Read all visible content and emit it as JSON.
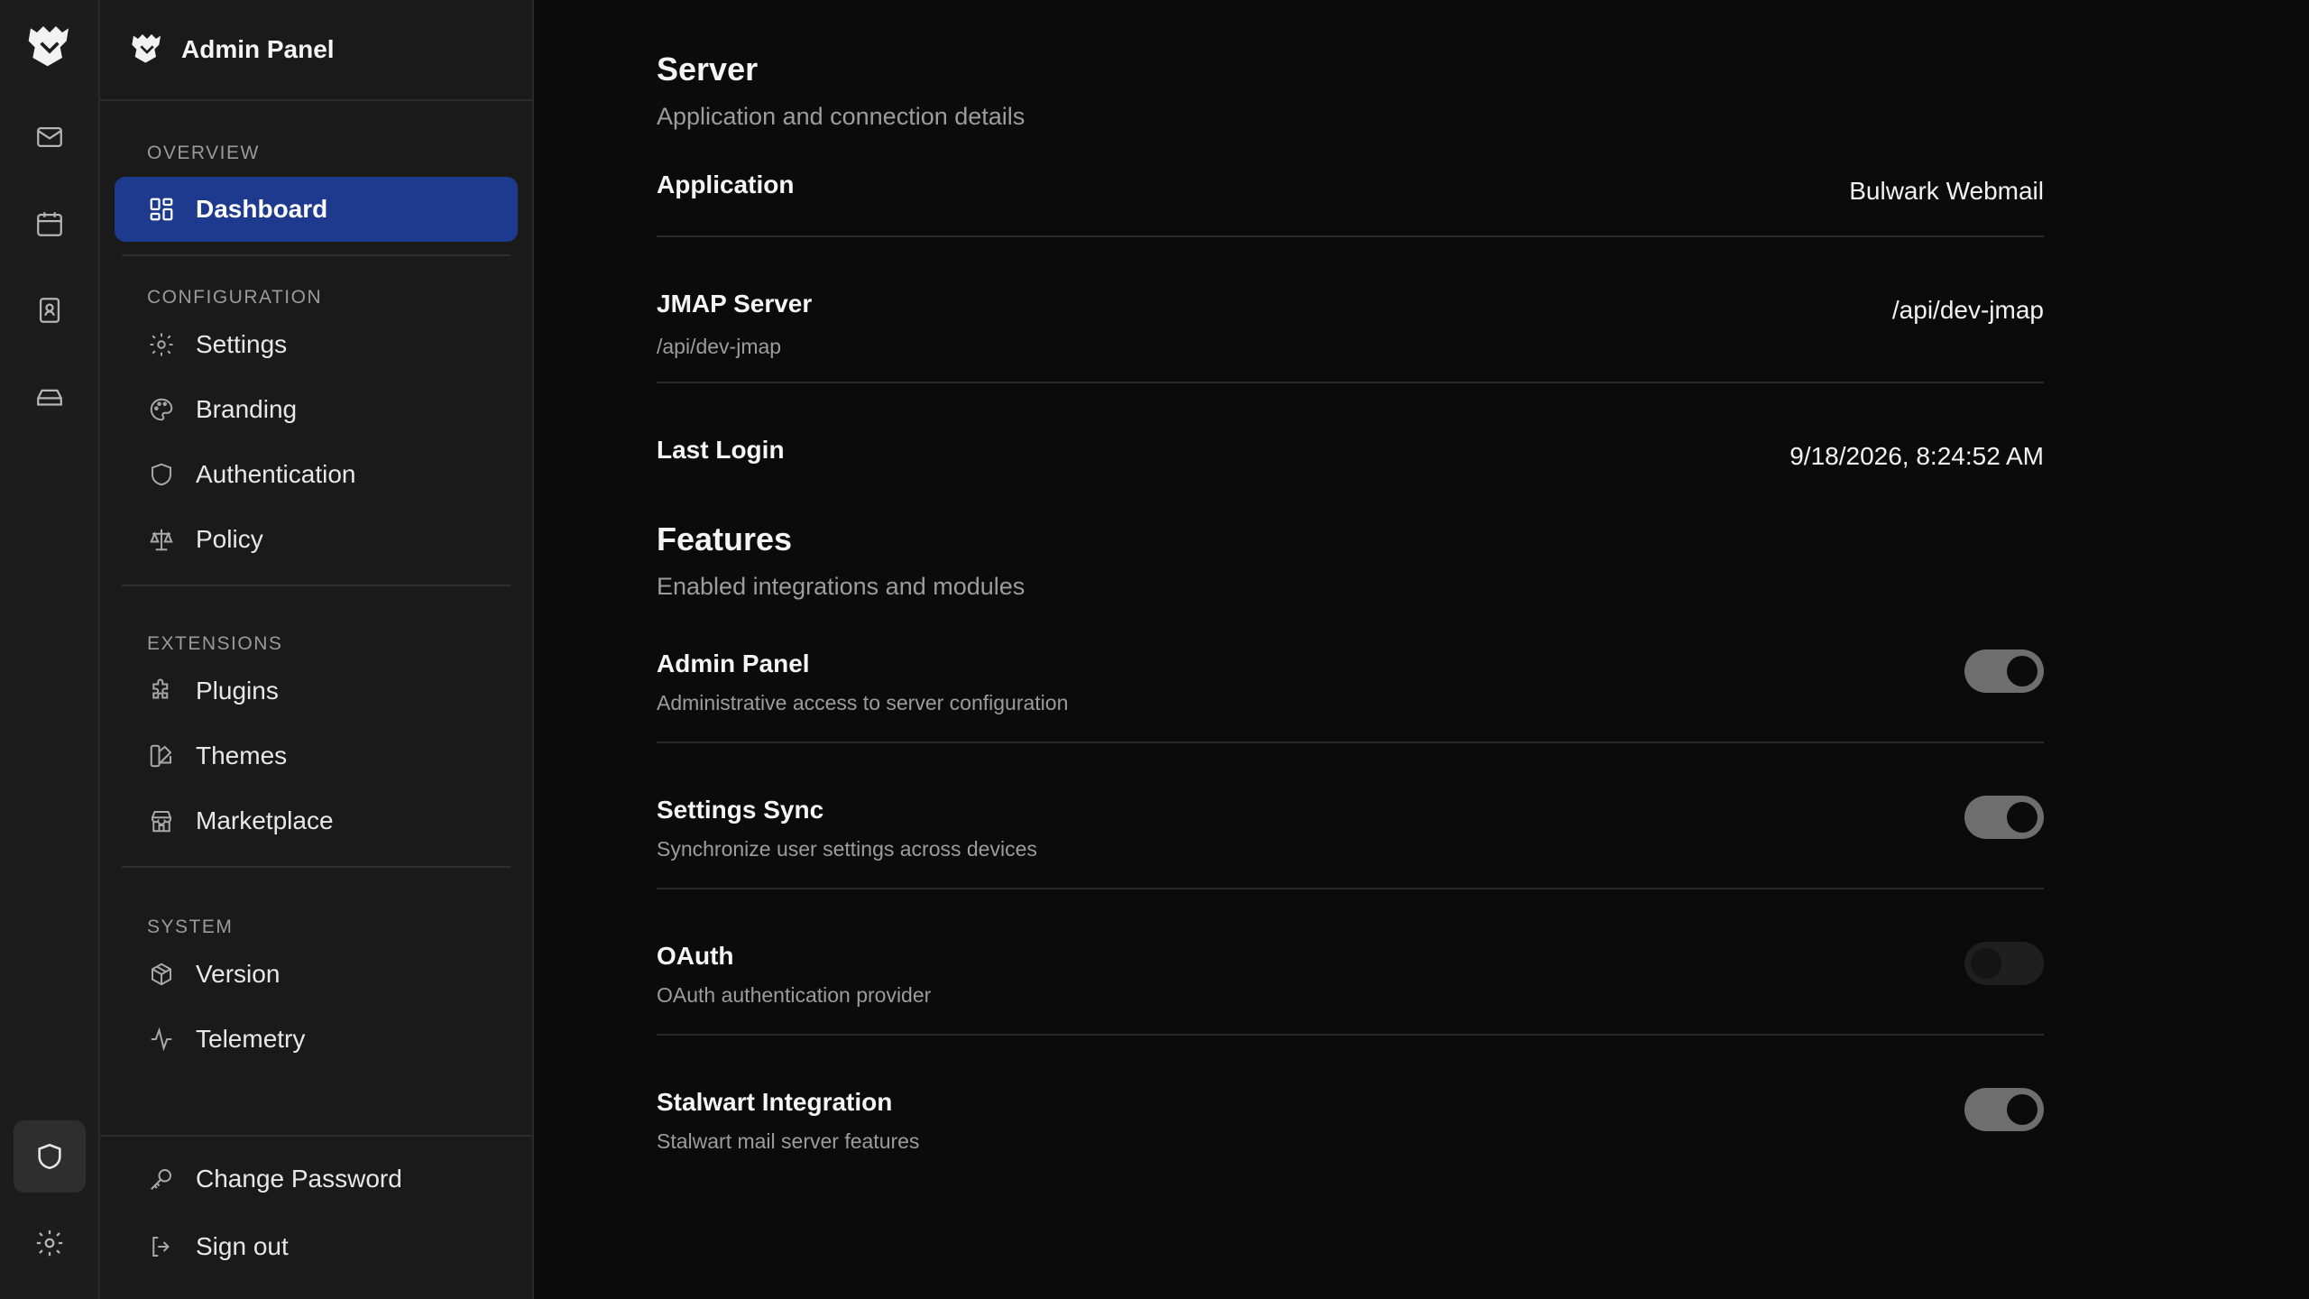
{
  "app": {
    "title": "Admin Panel"
  },
  "rail": {
    "items": [
      {
        "name": "mail-icon"
      },
      {
        "name": "calendar-icon"
      },
      {
        "name": "contacts-icon"
      },
      {
        "name": "drive-icon"
      }
    ],
    "bottom": [
      {
        "name": "shield-icon",
        "active": true
      },
      {
        "name": "gear-icon"
      }
    ]
  },
  "sidebar": {
    "sections": [
      {
        "title": "OVERVIEW",
        "items": [
          {
            "label": "Dashboard",
            "icon": "dashboard-icon",
            "active": true
          }
        ]
      },
      {
        "title": "CONFIGURATION",
        "items": [
          {
            "label": "Settings",
            "icon": "gear-icon"
          },
          {
            "label": "Branding",
            "icon": "palette-icon"
          },
          {
            "label": "Authentication",
            "icon": "shield-icon"
          },
          {
            "label": "Policy",
            "icon": "scale-icon"
          }
        ]
      },
      {
        "title": "EXTENSIONS",
        "items": [
          {
            "label": "Plugins",
            "icon": "puzzle-icon"
          },
          {
            "label": "Themes",
            "icon": "swatch-icon"
          },
          {
            "label": "Marketplace",
            "icon": "store-icon"
          }
        ]
      },
      {
        "title": "SYSTEM",
        "items": [
          {
            "label": "Version",
            "icon": "package-icon"
          },
          {
            "label": "Telemetry",
            "icon": "activity-icon"
          }
        ]
      }
    ],
    "footer": [
      {
        "label": "Change Password",
        "icon": "key-icon"
      },
      {
        "label": "Sign out",
        "icon": "logout-icon"
      }
    ]
  },
  "server": {
    "title": "Server",
    "subtitle": "Application and connection details",
    "rows": [
      {
        "label": "Application",
        "desc": "",
        "value": "Bulwark Webmail"
      },
      {
        "label": "JMAP Server",
        "desc": "/api/dev-jmap",
        "value": "/api/dev-jmap"
      },
      {
        "label": "Last Login",
        "desc": "",
        "value": "9/18/2026, 8:24:52 AM"
      }
    ]
  },
  "features": {
    "title": "Features",
    "subtitle": "Enabled integrations and modules",
    "items": [
      {
        "label": "Admin Panel",
        "desc": "Administrative access to server configuration",
        "enabled": true
      },
      {
        "label": "Settings Sync",
        "desc": "Synchronize user settings across devices",
        "enabled": true
      },
      {
        "label": "OAuth",
        "desc": "OAuth authentication provider",
        "enabled": false
      },
      {
        "label": "Stalwart Integration",
        "desc": "Stalwart mail server features",
        "enabled": true
      }
    ]
  }
}
